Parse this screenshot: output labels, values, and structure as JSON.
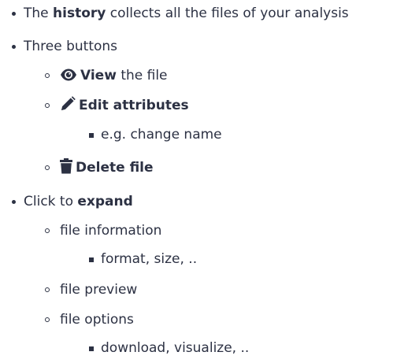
{
  "list": {
    "history": {
      "prefix": "The ",
      "bold": "history",
      "suffix": " collects all the files of your analysis"
    },
    "three_buttons": {
      "label": "Three buttons",
      "view": {
        "icon": "eye-icon",
        "bold": "View",
        "suffix": " the file"
      },
      "edit": {
        "icon": "pencil-icon",
        "bold": "Edit attributes",
        "sub": "e.g. change name"
      },
      "delete": {
        "icon": "trash-icon",
        "bold": "Delete file"
      }
    },
    "expand": {
      "prefix": "Click to ",
      "bold": "expand",
      "info": {
        "label": "file information",
        "sub": "format, size, .."
      },
      "preview": {
        "label": "file preview"
      },
      "options": {
        "label": "file options",
        "sub": "download, visualize, .."
      }
    }
  },
  "colors": {
    "text": "#2c3143",
    "background": "#ffffff"
  }
}
